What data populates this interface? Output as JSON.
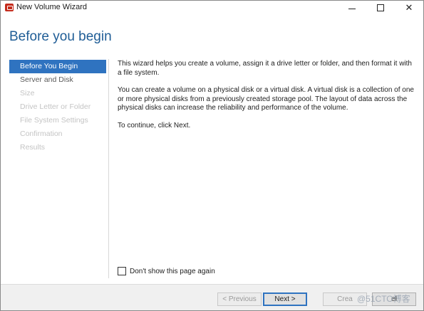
{
  "window": {
    "title": "New Volume Wizard",
    "controls": {
      "minimize": "minimize-icon",
      "maximize": "maximize-icon",
      "close": "close-icon"
    }
  },
  "page": {
    "title": "Before you begin"
  },
  "sidebar": {
    "steps": [
      {
        "label": "Before You Begin",
        "state": "active"
      },
      {
        "label": "Server and Disk",
        "state": "enabled"
      },
      {
        "label": "Size",
        "state": "disabled"
      },
      {
        "label": "Drive Letter or Folder",
        "state": "disabled"
      },
      {
        "label": "File System Settings",
        "state": "disabled"
      },
      {
        "label": "Confirmation",
        "state": "disabled"
      },
      {
        "label": "Results",
        "state": "disabled"
      }
    ]
  },
  "content": {
    "paragraphs": [
      "This wizard helps you create a volume, assign it a drive letter or folder, and then format it with a file system.",
      "You can create a volume on a physical disk or a virtual disk. A virtual disk is a collection of one or more physical disks from a previously created storage pool. The layout of data across the physical disks can increase the reliability and performance of the volume.",
      "To continue, click Next."
    ]
  },
  "options": {
    "dont_show_label": "Don't show this page again",
    "dont_show_checked": false
  },
  "buttons": {
    "previous": "< Previous",
    "next": "Next >",
    "create": "Crea",
    "cancel": "el"
  },
  "watermark": "@51CTO博客",
  "colors": {
    "accent": "#2f73c0",
    "title": "#1f5d96"
  }
}
